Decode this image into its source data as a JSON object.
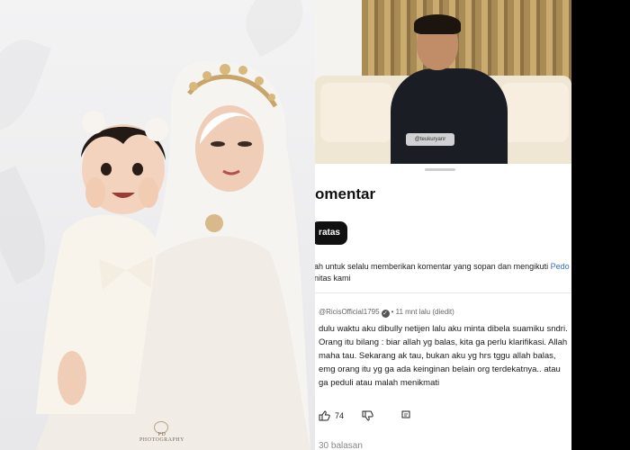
{
  "photo": {
    "credit": "PD PHOTOGRAPHY",
    "colors": {
      "background": "#efeff0",
      "veil": "#f6f4f1",
      "dress": "#f4efe7",
      "crown": "#c9a56a"
    }
  },
  "video": {
    "watermark": "@teukuryanr"
  },
  "comments": {
    "title": "omentar",
    "sort_chip": "ratas",
    "notice_text": "ah untuk selalu memberikan komentar yang sopan dan mengikuti ",
    "notice_link": "Pedo",
    "notice_line2": "nitas kami",
    "comment": {
      "handle": "@RicisOfficial1795",
      "meta": "• 11 mnt lalu (diedit)",
      "text": "dulu waktu aku dibully netijen lalu aku minta dibela suamiku sndri. Orang itu bilang : biar allah yg balas, kita ga perlu klarifikasi. Allah maha tau. Sekarang ak tau, bukan aku yg hrs tggu allah balas, emg orang itu yg ga ada keinginan belain org terdekatnya.. atau ga peduli atau malah menikmati",
      "likes": "74"
    },
    "replies": "30 balasan"
  },
  "colors": {
    "link": "#2f6fd6",
    "chip": "#111111",
    "edge_bar": "#000000"
  }
}
